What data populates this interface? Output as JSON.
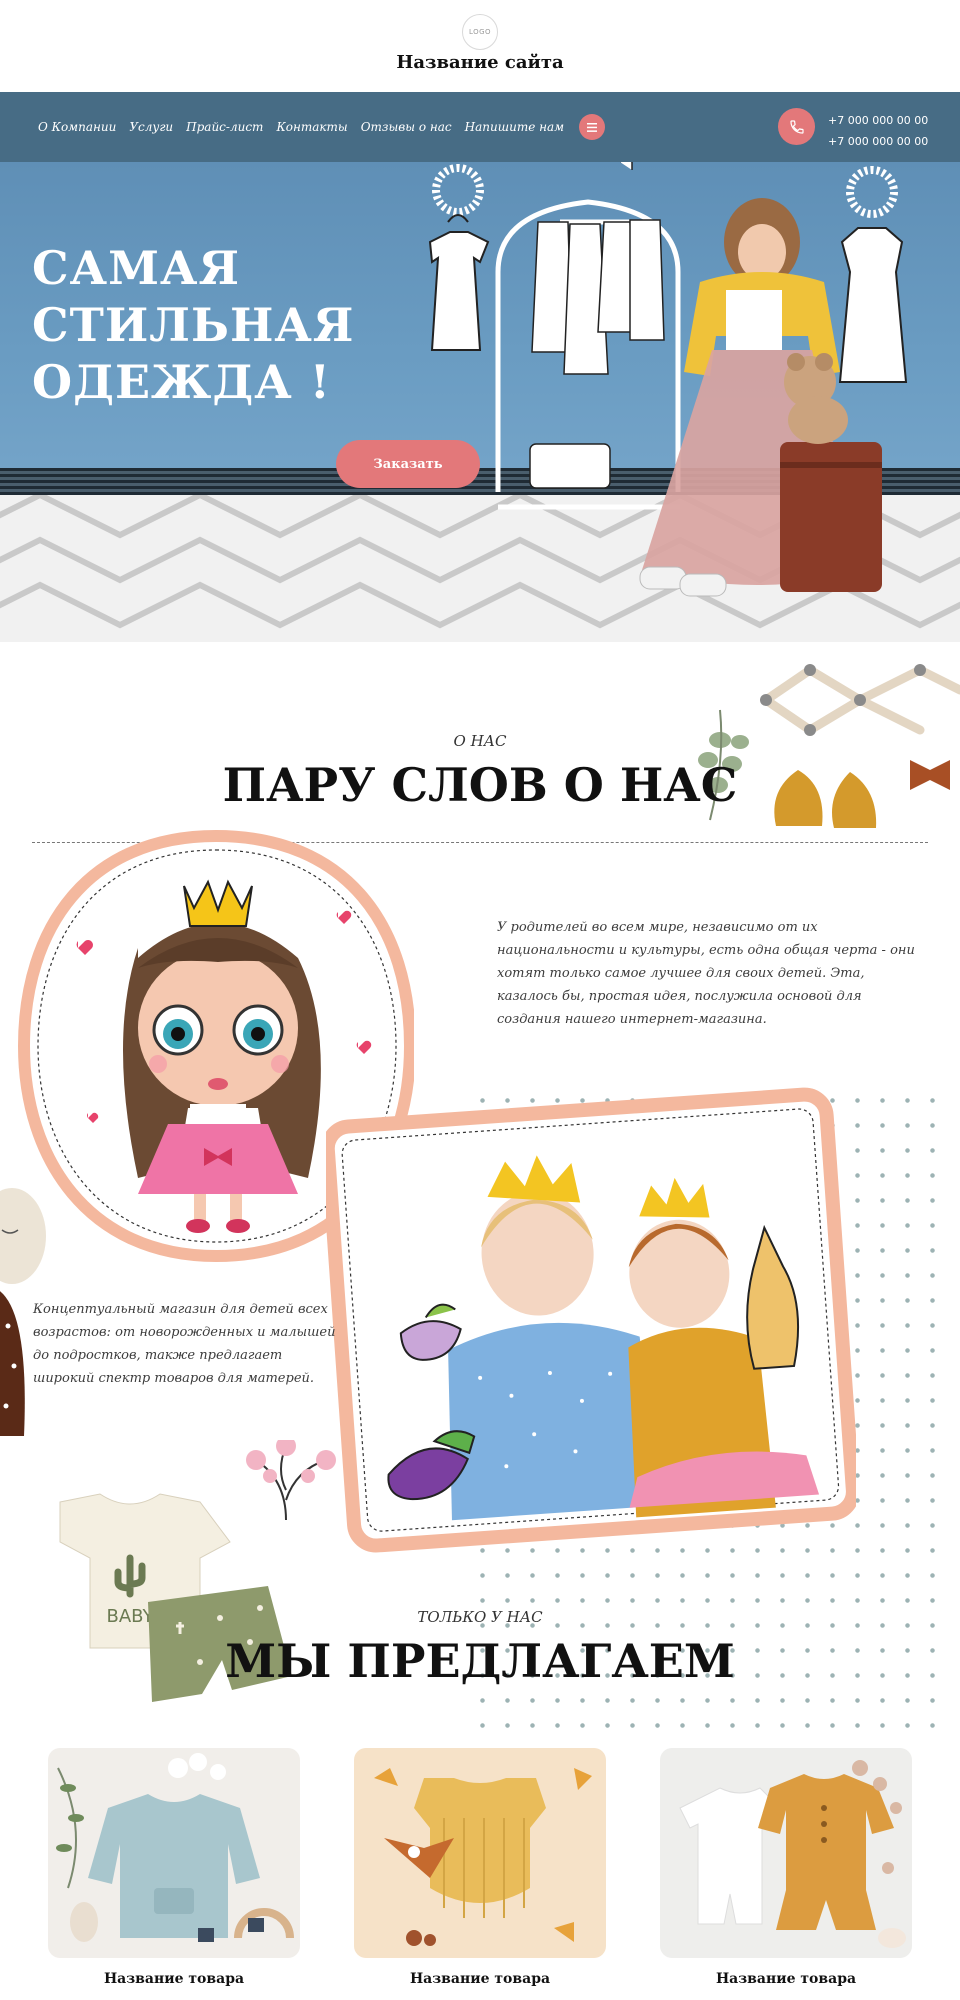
{
  "header": {
    "logo_text": "LOGO",
    "site_title": "Название сайта"
  },
  "nav": {
    "items": [
      "О Компании",
      "Услуги",
      "Прайс-лист",
      "Контакты",
      "Отзывы о нас",
      "Напишите нам"
    ],
    "phones": [
      "+7 000 000 00 00",
      "+7 000 000 00 00"
    ],
    "menu_icon": "hamburger-icon",
    "phone_icon": "phone-icon"
  },
  "hero": {
    "title_lines": [
      "САМАЯ",
      "СТИЛЬНАЯ",
      "ОДЕЖДА !"
    ],
    "button_label": "Заказать"
  },
  "about": {
    "eyebrow": "О НАС",
    "heading": "ПАРУ СЛОВ О НАС",
    "text_1": "У родителей во всем мире, независимо от их национальности и культуры, есть одна общая черта - они хотят только самое лучшее для своих детей. Эта, казалось бы, простая идея, послужила основой для создания нашего интернет-магазина.",
    "text_2": "Концептуальный магазин для детей всех возрастов: от новорожденных и малышей до подростков, также предлагает широкий спектр товаров для матерей."
  },
  "tshirt_print": "BABY",
  "offers": {
    "eyebrow": "ТОЛЬКО У НАС",
    "heading": "МЫ ПРЕДЛАГАЕМ",
    "products": [
      {
        "name": "Название товара"
      },
      {
        "name": "Название товара"
      },
      {
        "name": "Название товара"
      }
    ]
  },
  "colors": {
    "accent": "#e3787a",
    "nav_bg": "#476c85",
    "hero_bg": "#6a9cc2",
    "frame_peach": "#f4b89e"
  }
}
